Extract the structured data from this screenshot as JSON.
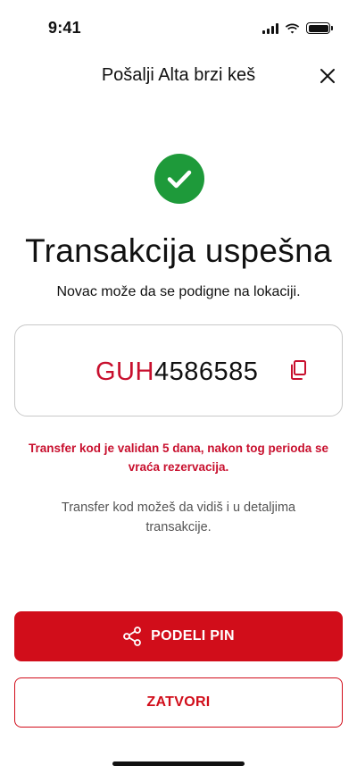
{
  "status_bar": {
    "time": "9:41",
    "icons": [
      "signal-icon",
      "wifi-icon",
      "battery-icon"
    ]
  },
  "header": {
    "title": "Pošalji Alta brzi keš",
    "close_icon": "close-icon"
  },
  "success": {
    "icon": "check-circle-icon",
    "title": "Transakcija uspešna",
    "subtitle": "Novac može da se podigne na lokaciji."
  },
  "code": {
    "prefix": "GUH",
    "number": "4586585",
    "copy_icon": "copy-icon"
  },
  "warning_text": "Transfer kod je validan 5 dana, nakon tog perioda se vraća rezervacija.",
  "info_text": "Transfer kod možeš da vidiš i u detaljima transakcije.",
  "actions": {
    "share_label": "PODELI PIN",
    "share_icon": "share-icon",
    "close_label": "ZATVORI"
  },
  "colors": {
    "brand_red": "#d10d1a",
    "success_green": "#1e9a3a"
  }
}
